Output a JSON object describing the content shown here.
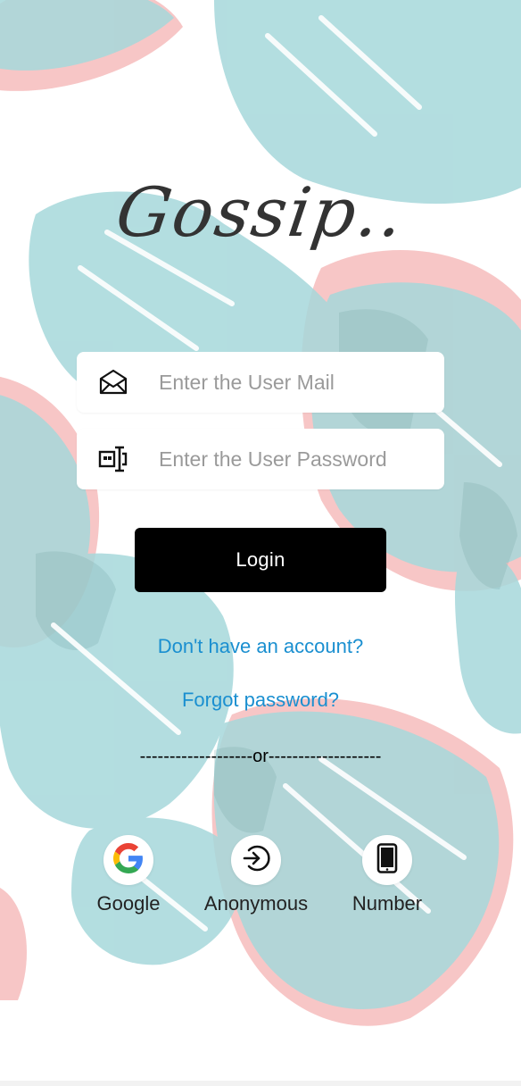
{
  "app": {
    "title": "Gossip.."
  },
  "form": {
    "email_placeholder": "Enter the User Mail",
    "email_icon": "envelope-icon",
    "password_placeholder": "Enter the User Password",
    "password_icon": "password-field-icon",
    "login_label": "Login"
  },
  "links": {
    "signup": "Don't have an account?",
    "forgot": "Forgot password?"
  },
  "divider": "-------------------or-------------------",
  "auth_options": [
    {
      "label": "Google",
      "icon": "google-icon"
    },
    {
      "label": "Anonymous",
      "icon": "sign-in-icon"
    },
    {
      "label": "Number",
      "icon": "phone-icon"
    }
  ],
  "colors": {
    "link": "#1a8fd0",
    "button": "#000000",
    "leaf_teal": "#9fd3d8",
    "leaf_pink": "#f2a8a8"
  }
}
